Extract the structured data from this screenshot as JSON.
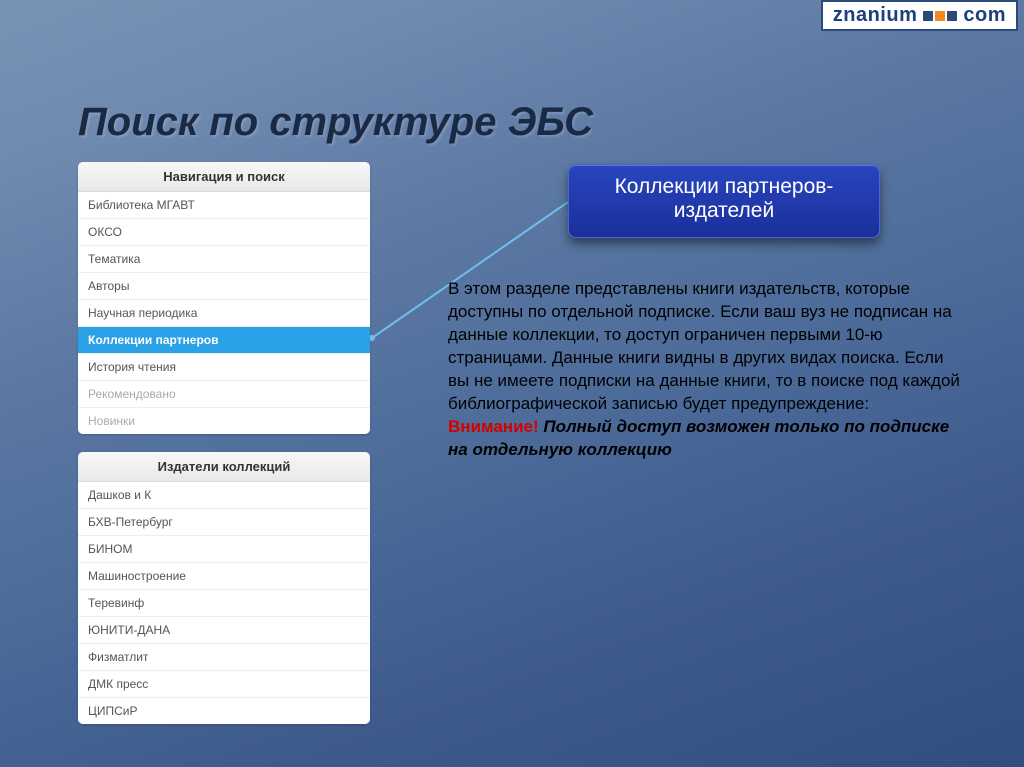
{
  "logo": {
    "text_a": "znanium",
    "text_b": "com"
  },
  "slide_title": "Поиск по структуре ЭБС",
  "nav_panel": {
    "header": "Навигация и поиск",
    "items": [
      {
        "label": "Библиотека МГАВТ",
        "state": "normal"
      },
      {
        "label": "ОКСО",
        "state": "normal"
      },
      {
        "label": "Тематика",
        "state": "normal"
      },
      {
        "label": "Авторы",
        "state": "normal"
      },
      {
        "label": "Научная периодика",
        "state": "normal"
      },
      {
        "label": "Коллекции партнеров",
        "state": "active"
      },
      {
        "label": "История чтения",
        "state": "normal"
      },
      {
        "label": "Рекомендовано",
        "state": "muted"
      },
      {
        "label": "Новинки",
        "state": "muted"
      }
    ]
  },
  "publishers_panel": {
    "header": "Издатели коллекций",
    "items": [
      {
        "label": "Дашков и К"
      },
      {
        "label": "БХВ-Петербург"
      },
      {
        "label": "БИНОМ"
      },
      {
        "label": "Машиностроение"
      },
      {
        "label": "Теревинф"
      },
      {
        "label": "ЮНИТИ-ДАНА"
      },
      {
        "label": "Физматлит"
      },
      {
        "label": "ДМК пресс"
      },
      {
        "label": "ЦИПСиР"
      }
    ]
  },
  "callout": {
    "line1": "Коллекции партнеров-",
    "line2": "издателей"
  },
  "description": {
    "body": "В этом разделе представлены книги издательств, которые доступны по отдельной подписке. Если ваш вуз не подписан на данные коллекции, то доступ ограничен первыми 10-ю страницами. Данные книги видны в других видах поиска. Если вы не имеете подписки на данные книги, то в поиске под каждой библиографической записью будет предупреждение:",
    "warn": "Внимание!",
    "emph": "Полный доступ возможен только по подписке на отдельную коллекцию"
  }
}
